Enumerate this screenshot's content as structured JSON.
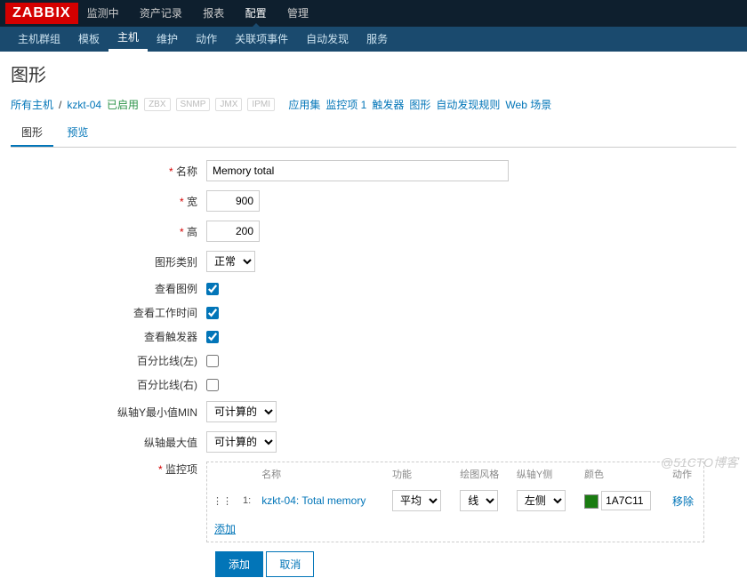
{
  "logo": "ZABBIX",
  "topnav": [
    "监测中",
    "资产记录",
    "报表",
    "配置",
    "管理"
  ],
  "topnav_active": 3,
  "subnav": [
    "主机群组",
    "模板",
    "主机",
    "维护",
    "动作",
    "关联项事件",
    "自动发现",
    "服务"
  ],
  "subnav_active": 2,
  "page_title": "图形",
  "breadcrumb": {
    "all_hosts": "所有主机",
    "host": "kzkt-04",
    "enabled": "已启用",
    "tags": [
      "ZBX",
      "SNMP",
      "JMX",
      "IPMI"
    ],
    "links": [
      "应用集",
      "监控项 1",
      "触发器",
      "图形",
      "自动发现规则",
      "Web 场景"
    ]
  },
  "tabs": {
    "graph": "图形",
    "preview": "预览",
    "active": 0
  },
  "form": {
    "name_label": "名称",
    "name_value": "Memory total",
    "width_label": "宽",
    "width_value": "900",
    "height_label": "高",
    "height_value": "200",
    "type_label": "图形类别",
    "type_value": "正常",
    "legend_label": "查看图例",
    "legend_checked": true,
    "worktime_label": "查看工作时间",
    "worktime_checked": true,
    "triggers_label": "查看触发器",
    "triggers_checked": true,
    "percent_left_label": "百分比线(左)",
    "percent_left_checked": false,
    "percent_right_label": "百分比线(右)",
    "percent_right_checked": false,
    "ymin_label": "纵轴Y最小值MIN",
    "ymin_value": "可计算的",
    "ymax_label": "纵轴最大值",
    "ymax_value": "可计算的",
    "items_label": "监控项"
  },
  "items_table": {
    "headers": {
      "name": "名称",
      "func": "功能",
      "style": "绘图风格",
      "yaxis": "纵轴Y侧",
      "color": "颜色",
      "action": "动作"
    },
    "row": {
      "idx": "1:",
      "name": "kzkt-04: Total memory",
      "func": "平均",
      "style": "线",
      "yaxis": "左侧",
      "color": "1A7C11",
      "remove": "移除"
    },
    "add": "添加"
  },
  "buttons": {
    "add": "添加",
    "cancel": "取消"
  },
  "watermark": "@51CTO博客"
}
